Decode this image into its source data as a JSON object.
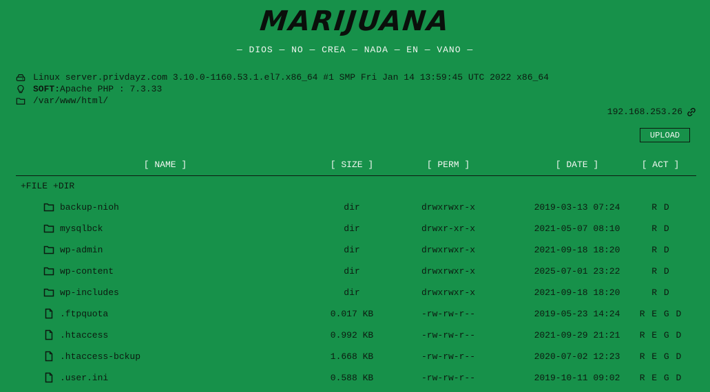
{
  "header": {
    "brand": "MARIJUANA",
    "motto": "— DIOS — NO — CREA — NADA — EN — VANO —"
  },
  "system": {
    "uname": "Linux server.privdayz.com 3.10.0-1160.53.1.el7.x86_64 #1 SMP Fri Jan 14 13:59:45 UTC 2022 x86_64",
    "soft_label": "SOFT",
    "soft_sep": " : ",
    "soft_value": "Apache PHP : 7.3.33",
    "path": "/var/www/html/",
    "ip": "192.168.253.26"
  },
  "toolbar": {
    "upload_label": "UPLOAD",
    "new_file": "+FILE",
    "new_dir": "+DIR"
  },
  "table": {
    "headers": {
      "name": "[ NAME ]",
      "size": "[ SIZE ]",
      "perm": "[ PERM ]",
      "date": "[ DATE ]",
      "act": "[ ACT ]"
    },
    "rows": [
      {
        "type": "folder-icon",
        "name": "backup-nioh",
        "size": "dir",
        "perm": "drwxrwxr-x",
        "date": "2019-03-13 07:24",
        "act": "R D"
      },
      {
        "type": "folder-icon",
        "name": "mysqlbck",
        "size": "dir",
        "perm": "drwxr-xr-x",
        "date": "2021-05-07 08:10",
        "act": "R D"
      },
      {
        "type": "folder-icon",
        "name": "wp-admin",
        "size": "dir",
        "perm": "drwxrwxr-x",
        "date": "2021-09-18 18:20",
        "act": "R D"
      },
      {
        "type": "folder-icon",
        "name": "wp-content",
        "size": "dir",
        "perm": "drwxrwxr-x",
        "date": "2025-07-01 23:22",
        "act": "R D"
      },
      {
        "type": "folder-icon",
        "name": "wp-includes",
        "size": "dir",
        "perm": "drwxrwxr-x",
        "date": "2021-09-18 18:20",
        "act": "R D"
      },
      {
        "type": "file-icon",
        "name": ".ftpquota",
        "size": "0.017 KB",
        "perm": "-rw-rw-r--",
        "date": "2019-05-23 14:24",
        "act": "R E G D"
      },
      {
        "type": "file-icon",
        "name": ".htaccess",
        "size": "0.992 KB",
        "perm": "-rw-rw-r--",
        "date": "2021-09-29 21:21",
        "act": "R E G D"
      },
      {
        "type": "file-icon",
        "name": ".htaccess-bckup",
        "size": "1.668 KB",
        "perm": "-rw-rw-r--",
        "date": "2020-07-02 12:23",
        "act": "R E G D"
      },
      {
        "type": "file-icon",
        "name": ".user.ini",
        "size": "0.588 KB",
        "perm": "-rw-rw-r--",
        "date": "2019-10-11 09:02",
        "act": "R E G D"
      }
    ]
  },
  "colors": {
    "background": "#17914a",
    "text_dark": "#0c1a10",
    "text_light": "#f1f7f1"
  }
}
